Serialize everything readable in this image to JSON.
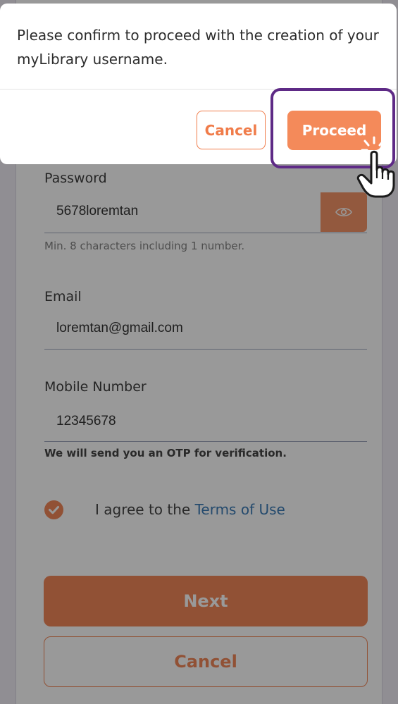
{
  "dialog": {
    "message": "Please confirm to proceed with the creation of your myLibrary username.",
    "cancel_label": "Cancel",
    "proceed_label": "Proceed"
  },
  "form": {
    "password": {
      "label": "Password",
      "value": "5678loremtan",
      "hint": "Min. 8 characters including 1 number."
    },
    "email": {
      "label": "Email",
      "value": "loremtan@gmail.com"
    },
    "mobile": {
      "label": "Mobile Number",
      "value": "12345678",
      "hint": "We will send you an OTP for verification."
    },
    "agree_text": "I agree to the ",
    "terms_link": "Terms of Use",
    "next_label": "Next",
    "cancel_label": "Cancel"
  },
  "colors": {
    "accent": "#f07c4a",
    "highlight": "#5e2a86",
    "link": "#2a6fb0"
  },
  "icons": [
    "eye-icon",
    "checkmark-icon",
    "hand-pointer-icon"
  ]
}
